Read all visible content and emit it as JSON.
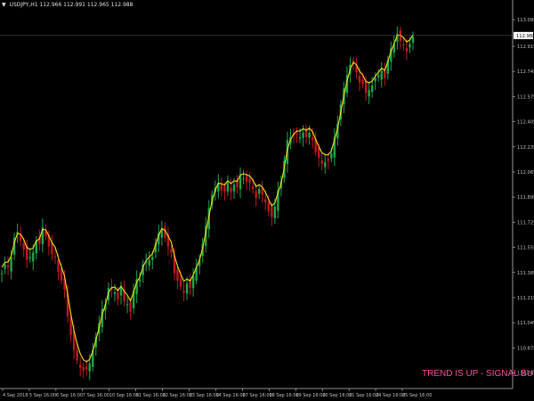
{
  "header": {
    "arrow": "▼",
    "symbol": "USDJPY,H1",
    "quote": "112.966 112.991 112.965 112.988"
  },
  "price_axis": {
    "labels": [
      "113.095",
      "112.915",
      "112.745",
      "112.575",
      "112.405",
      "112.235",
      "112.065",
      "111.895",
      "111.725",
      "111.555",
      "111.385",
      "111.215",
      "111.045",
      "110.875",
      "110.705"
    ],
    "current_price": "112.988",
    "label_color": "#c0c0c0"
  },
  "time_axis": {
    "labels": [
      "4 Sep 2018",
      "5 Sep 16:00",
      "6 Sep 16:00",
      "7 Sep 16:00",
      "10 Sep 16:00",
      "11 Sep 16:00",
      "12 Sep 16:00",
      "13 Sep 16:00",
      "14 Sep 16:00",
      "17 Sep 16:00",
      "18 Sep 16:00",
      "19 Sep 16:00",
      "20 Sep 16:00",
      "21 Sep 16:00",
      "24 Sep 16:00",
      "25 Sep 16:00"
    ]
  },
  "signal": {
    "text": "TREND IS UP - SIGNAL BUY",
    "icon": "hand-pointer-icon",
    "color": "#ff4d9e"
  },
  "colors": {
    "background": "#000000",
    "bull_candle": "#1fa84b",
    "bear_candle": "#c0191f",
    "trend_line": "#f0e020",
    "axis": "#c0c0c0"
  },
  "chart_data": {
    "type": "line",
    "series": [
      {
        "values": [
          111.38,
          111.44,
          111.42,
          111.49,
          111.62,
          111.66,
          111.6,
          111.54,
          111.47,
          111.49,
          111.52,
          111.6,
          111.58,
          111.69,
          111.63,
          111.56,
          111.51,
          111.49,
          111.39,
          111.33,
          111.27,
          111.09,
          110.96,
          110.86,
          110.79,
          110.74,
          110.72,
          110.73,
          110.77,
          110.86,
          110.95,
          111.04,
          111.14,
          111.17,
          111.28,
          111.27,
          111.25,
          111.2,
          111.28,
          111.19,
          111.17,
          111.12,
          111.26,
          111.34,
          111.34,
          111.44,
          111.46,
          111.47,
          111.49,
          111.58,
          111.65,
          111.68,
          111.62,
          111.56,
          111.52,
          111.38,
          111.33,
          111.29,
          111.25,
          111.31,
          111.28,
          111.36,
          111.42,
          111.47,
          111.58,
          111.7,
          111.82,
          111.91,
          111.96,
          111.99,
          111.94,
          111.93,
          111.99,
          111.93,
          111.98,
          111.96,
          112.04,
          112.02,
          112.0,
          111.99,
          111.95,
          111.89,
          111.95,
          111.91,
          111.86,
          111.8,
          111.76,
          111.83,
          111.94,
          112.0,
          112.14,
          112.28,
          112.3,
          112.31,
          112.32,
          112.3,
          112.33,
          112.3,
          112.33,
          112.28,
          112.2,
          112.16,
          112.12,
          112.13,
          112.14,
          112.19,
          112.3,
          112.39,
          112.52,
          112.63,
          112.72,
          112.79,
          112.8,
          112.74,
          112.67,
          112.66,
          112.6,
          112.62,
          112.65,
          112.7,
          112.72,
          112.75,
          112.7,
          112.82,
          112.9,
          112.93,
          113.0,
          112.95,
          112.92,
          112.88,
          112.93,
          112.98
        ]
      }
    ],
    "ylim": [
      110.6,
      113.18
    ],
    "grid": false
  }
}
